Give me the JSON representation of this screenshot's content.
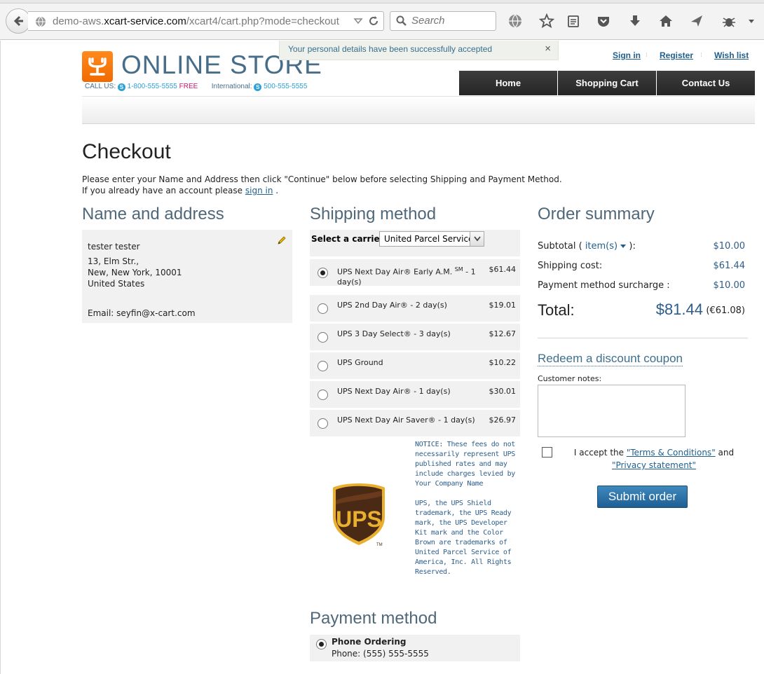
{
  "browser": {
    "url_prefix": "demo-aws.",
    "url_host": "xcart-service.com",
    "url_path": "/xcart4/cart.php?mode=checkout",
    "search_placeholder": "Search"
  },
  "header": {
    "logo_text": "ONLINE STORE",
    "call_us_label": "CALL US:",
    "call_us_phone": "1-800-555-5555",
    "call_us_free": "FREE",
    "international_label": "International:",
    "international_phone": "500-555-5555",
    "notice": "Your personal details have been successfully accepted",
    "notice_close": "×",
    "links": {
      "sign_in": "Sign in",
      "register": "Register",
      "wish_list": "Wish list"
    },
    "nav": {
      "home": "Home",
      "cart": "Shopping Cart",
      "contact": "Contact Us"
    }
  },
  "checkout": {
    "title": "Checkout",
    "intro_line1": "Please enter your Name and Address then click \"Continue\" below before selecting Shipping and Payment Method.",
    "intro_line2_pre": "If you already have an account please ",
    "intro_link": "sign in",
    "intro_line2_post": " ."
  },
  "address": {
    "heading": "Name and address",
    "name": "tester tester",
    "street": "13, Elm Str.,",
    "city": "New, New York, 10001",
    "country": "United States",
    "email": "Email: seyfin@x-cart.com"
  },
  "shipping": {
    "heading": "Shipping method",
    "carrier_label": "Select a carrier:",
    "carrier_value": "United Parcel Service",
    "options": [
      {
        "name": "UPS Next Day Air® Early A.M. SM - 1 day(s)",
        "price": "$61.44",
        "selected": true
      },
      {
        "name": "UPS 2nd Day Air® - 2 day(s)",
        "price": "$19.01",
        "selected": false
      },
      {
        "name": "UPS 3 Day Select® - 3 day(s)",
        "price": "$12.67",
        "selected": false
      },
      {
        "name": "UPS Ground",
        "price": "$10.22",
        "selected": false
      },
      {
        "name": "UPS Next Day Air® - 1 day(s)",
        "price": "$30.01",
        "selected": false
      },
      {
        "name": "UPS Next Day Air Saver® - 1 day(s)",
        "price": "$26.97",
        "selected": false
      }
    ],
    "notice1": "NOTICE: These fees do not necessarily represent UPS published rates and may include charges levied by Your Company Name",
    "notice2": "UPS, the UPS Shield trademark, the UPS Ready mark, the UPS Developer Kit mark and the Color Brown are trademarks of United Parcel Service of America, Inc. All Rights Reserved.",
    "logo_text": "UPS"
  },
  "payment": {
    "heading": "Payment method",
    "option_name": "Phone Ordering",
    "option_desc": "Phone: (555) 555-5555"
  },
  "summary": {
    "heading": "Order summary",
    "subtotal_label_pre": "Subtotal ( ",
    "subtotal_items": "item(s)",
    "subtotal_label_post": " ):",
    "subtotal": "$10.00",
    "shipping_label": "Shipping cost:",
    "shipping": "$61.44",
    "surcharge_label": "Payment method surcharge :",
    "surcharge": "$10.00",
    "total_label": "Total:",
    "total": "$81.44",
    "total_alt": "(€61.08)",
    "coupon": "Redeem a discount coupon",
    "notes_label": "Customer notes:",
    "accept_pre": "I accept the ",
    "terms": "\"Terms & Conditions\"",
    "accept_and": " and ",
    "privacy": "\"Privacy statement\"",
    "submit": "Submit order"
  },
  "colors": {
    "accent": "#2c5d8a",
    "nav": "#2f2f2f",
    "logo": "#f27a0a"
  }
}
